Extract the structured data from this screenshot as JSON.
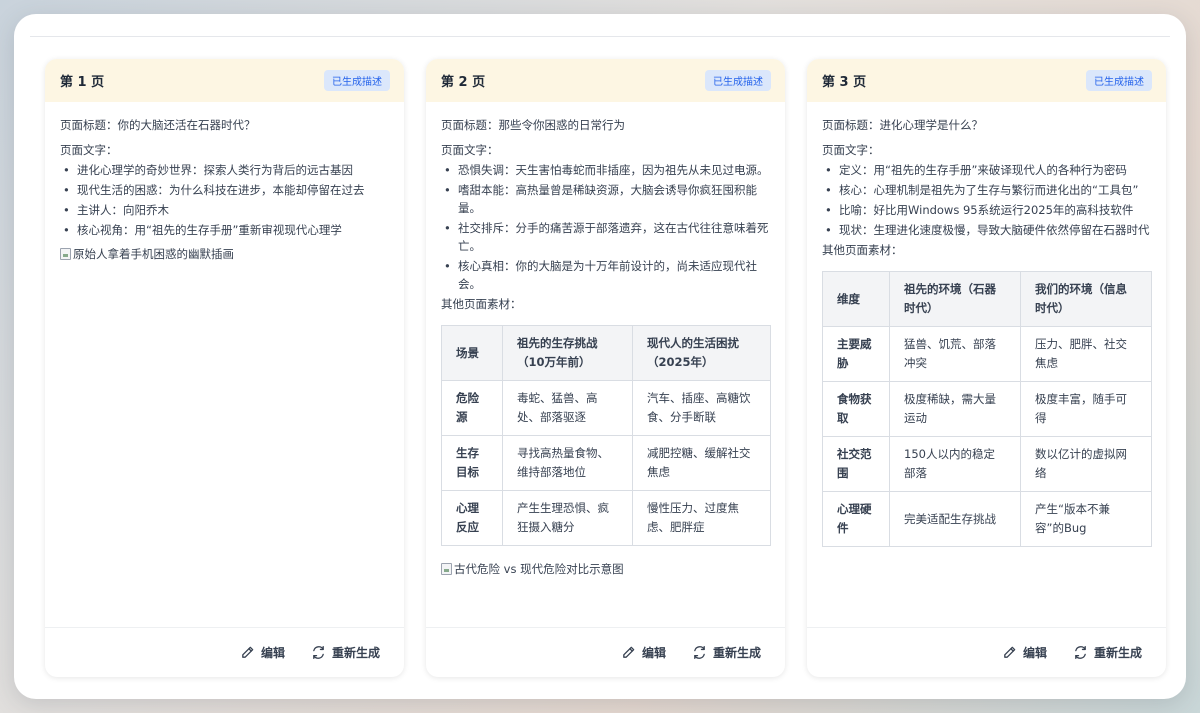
{
  "cards": [
    {
      "title": "第 1 页",
      "badge": "已生成描述",
      "page_title": "页面标题：你的大脑还活在石器时代？",
      "text_label": "页面文字：",
      "bullets": [
        "进化心理学的奇妙世界：探索人类行为背后的远古基因",
        "现代生活的困惑：为什么科技在进步，本能却停留在过去",
        "主讲人：向阳乔木",
        "核心视角：用“祖先的生存手册”重新审视现代心理学"
      ],
      "image_alt": "原始人拿着手机困惑的幽默插画",
      "edit_label": "编辑",
      "regen_label": "重新生成"
    },
    {
      "title": "第 2 页",
      "badge": "已生成描述",
      "page_title": "页面标题：那些令你困惑的日常行为",
      "text_label": "页面文字：",
      "bullets": [
        "恐惧失调：天生害怕毒蛇而非插座，因为祖先从未见过电源。",
        "嗜甜本能：高热量曾是稀缺资源，大脑会诱导你疯狂囤积能量。",
        "社交排斥：分手的痛苦源于部落遗弃，这在古代往往意味着死亡。",
        "核心真相：你的大脑是为十万年前设计的，尚未适应现代社会。"
      ],
      "materials_label": "其他页面素材：",
      "table": {
        "headers": [
          "场景",
          "祖先的生存挑战（10万年前）",
          "现代人的生活困扰（2025年）"
        ],
        "rows": [
          [
            "危险源",
            "毒蛇、猛兽、高处、部落驱逐",
            "汽车、插座、高糖饮食、分手断联"
          ],
          [
            "生存目标",
            "寻找高热量食物、维持部落地位",
            "减肥控糖、缓解社交焦虑"
          ],
          [
            "心理反应",
            "产生生理恐惧、疯狂摄入糖分",
            "慢性压力、过度焦虑、肥胖症"
          ]
        ]
      },
      "image_alt": "古代危险 vs 现代危险对比示意图",
      "edit_label": "编辑",
      "regen_label": "重新生成"
    },
    {
      "title": "第 3 页",
      "badge": "已生成描述",
      "page_title": "页面标题：进化心理学是什么？",
      "text_label": "页面文字：",
      "bullets": [
        "定义：用“祖先的生存手册”来破译现代人的各种行为密码",
        "核心：心理机制是祖先为了生存与繁衍而进化出的“工具包”",
        "比喻：好比用Windows 95系统运行2025年的高科技软件",
        "现状：生理进化速度极慢，导致大脑硬件依然停留在石器时代"
      ],
      "materials_label": "其他页面素材：",
      "table": {
        "headers": [
          "维度",
          "祖先的环境（石器时代）",
          "我们的环境（信息时代）"
        ],
        "rows": [
          [
            "主要威胁",
            "猛兽、饥荒、部落冲突",
            "压力、肥胖、社交焦虑"
          ],
          [
            "食物获取",
            "极度稀缺，需大量运动",
            "极度丰富，随手可得"
          ],
          [
            "社交范围",
            "150人以内的稳定部落",
            "数以亿计的虚拟网络"
          ],
          [
            "心理硬件",
            "完美适配生存挑战",
            "产生“版本不兼容”的Bug"
          ]
        ]
      },
      "edit_label": "编辑",
      "regen_label": "重新生成"
    }
  ]
}
